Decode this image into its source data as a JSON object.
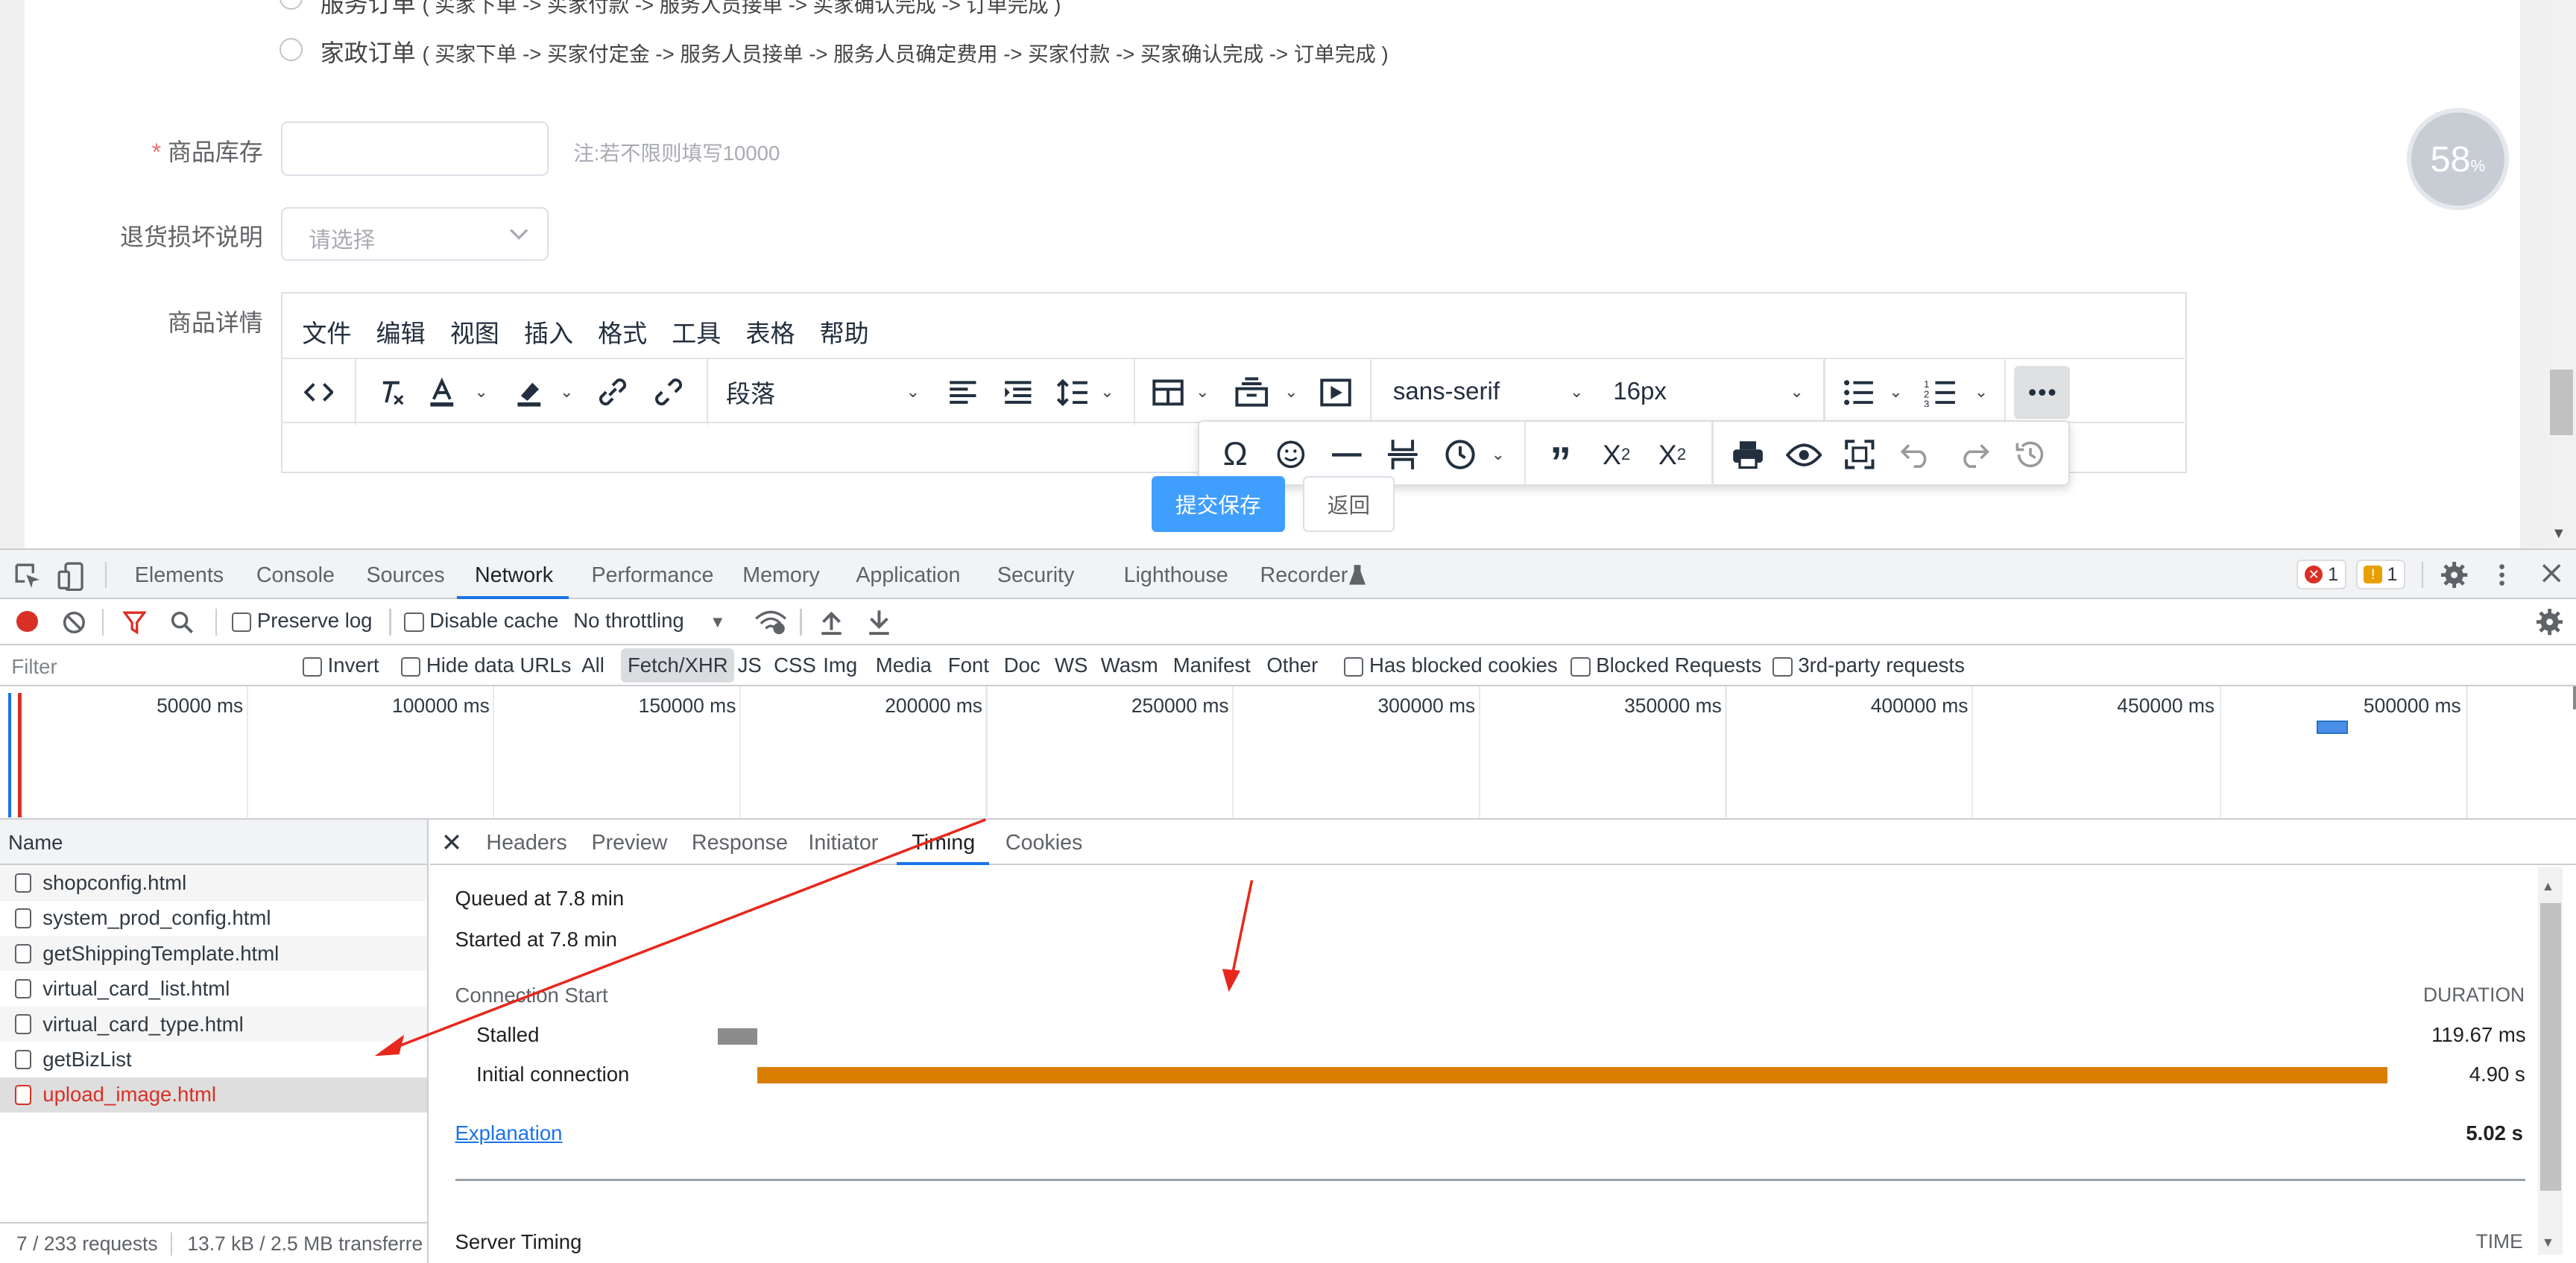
{
  "page": {
    "radio_top_label": "服务订单",
    "radio_top_desc": "( 买家下单 -> 买家付款 -> 服务人员接单 -> 买家确认完成 -> 订单完成 )",
    "radio_label": "家政订单",
    "radio_desc": "( 买家下单 -> 买家付定金 -> 服务人员接单 -> 服务人员确定费用 -> 买家付款 -> 买家确认完成 -> 订单完成 )",
    "required_mark": "*",
    "stock_label": "商品库存",
    "stock_value": "",
    "stock_hint": "注:若不限则填写10000",
    "return_label": "退货损坏说明",
    "return_placeholder": "请选择",
    "detail_label": "商品详情",
    "submit_button": "提交保存",
    "back_button": "返回",
    "progress_value": "58",
    "progress_unit": "%"
  },
  "editor": {
    "menu": [
      "文件",
      "编辑",
      "视图",
      "插入",
      "格式",
      "工具",
      "表格",
      "帮助"
    ],
    "block_format": "段落",
    "font_family": "sans-serif",
    "font_size": "16px",
    "icons": [
      "code-icon",
      "clear-format-icon",
      "text-color-icon",
      "highlight-icon",
      "link-icon",
      "unlink-icon",
      "align-left-icon",
      "indent-icon",
      "line-height-icon",
      "table-icon",
      "template-icon",
      "media-icon",
      "bullet-list-icon",
      "numbered-list-icon",
      "more-icon"
    ],
    "popup_icons": [
      "omega-icon",
      "emoji-icon",
      "hr-icon",
      "pagebreak-icon",
      "datetime-icon",
      "quote-icon",
      "subscript-icon",
      "superscript-icon",
      "print-icon",
      "preview-icon",
      "fullscreen-icon",
      "undo-icon",
      "redo-icon",
      "history-icon"
    ]
  },
  "devtools": {
    "tabs": [
      "Elements",
      "Console",
      "Sources",
      "Network",
      "Performance",
      "Memory",
      "Application",
      "Security",
      "Lighthouse",
      "Recorder"
    ],
    "active_tab": "Network",
    "error_count": "1",
    "warning_count": "1",
    "preserve_log": "Preserve log",
    "disable_cache": "Disable cache",
    "throttling": "No throttling",
    "filter_placeholder": "Filter",
    "invert": "Invert",
    "hide_data_urls": "Hide data URLs",
    "type_filters": [
      "All",
      "Fetch/XHR",
      "JS",
      "CSS",
      "Img",
      "Media",
      "Font",
      "Doc",
      "WS",
      "Wasm",
      "Manifest",
      "Other"
    ],
    "active_type": "Fetch/XHR",
    "has_blocked_cookies": "Has blocked cookies",
    "blocked_requests": "Blocked Requests",
    "third_party": "3rd-party requests",
    "timeline_labels": [
      "50000 ms",
      "100000 ms",
      "150000 ms",
      "200000 ms",
      "250000 ms",
      "300000 ms",
      "350000 ms",
      "400000 ms",
      "450000 ms",
      "500000 ms"
    ],
    "name_header": "Name",
    "requests": [
      "shopconfig.html",
      "system_prod_config.html",
      "getShippingTemplate.html",
      "virtual_card_list.html",
      "virtual_card_type.html",
      "getBizList",
      "upload_image.html"
    ],
    "selected_request": "upload_image.html",
    "footer_requests": "7 / 233 requests",
    "footer_transferred": "13.7 kB / 2.5 MB transferre",
    "detail_tabs": [
      "Headers",
      "Preview",
      "Response",
      "Initiator",
      "Timing",
      "Cookies"
    ],
    "active_detail_tab": "Timing",
    "queued": "Queued at 7.8 min",
    "started": "Started at 7.8 min",
    "connection_start": "Connection Start",
    "duration_header": "DURATION",
    "stalled_label": "Stalled",
    "stalled_value": "119.67 ms",
    "initial_label": "Initial connection",
    "initial_value": "4.90 s",
    "explanation": "Explanation",
    "total": "5.02 s",
    "server_timing": "Server Timing",
    "time_header": "TIME",
    "colors": {
      "stalled": "#8c8c8c",
      "initial": "#d97e00",
      "accent": "#1a73e8",
      "error": "#d93025"
    }
  }
}
